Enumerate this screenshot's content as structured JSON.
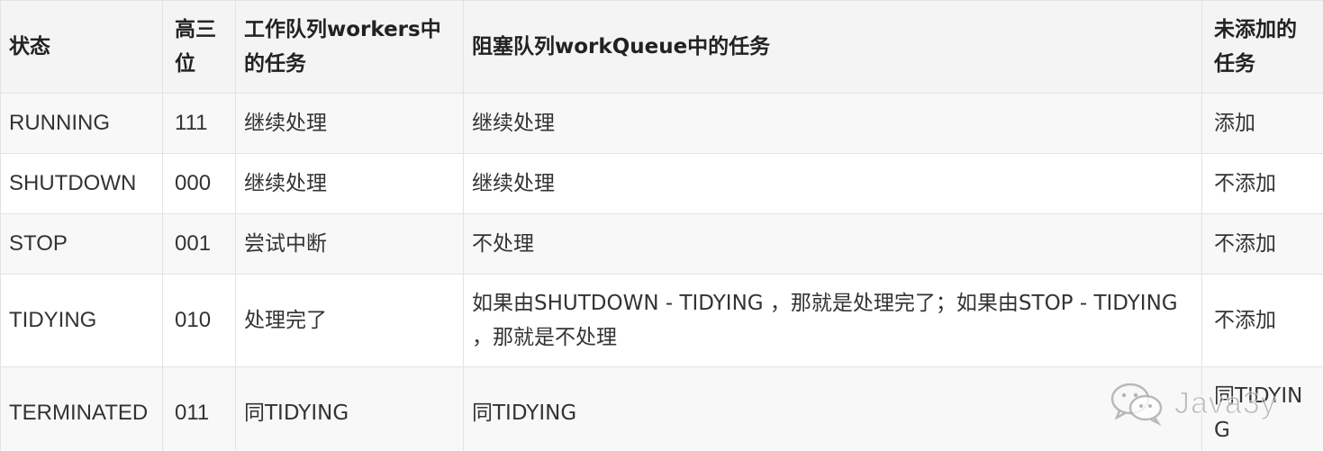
{
  "table": {
    "headers": {
      "state": "状态",
      "high_bits": "高三位",
      "workers_tasks": "工作队列workers中的任务",
      "queue_tasks": "阻塞队列workQueue中的任务",
      "new_tasks": "未添加的任务"
    },
    "rows": [
      {
        "state": "RUNNING",
        "high_bits": "111",
        "workers_tasks": "继续处理",
        "queue_tasks": "继续处理",
        "new_tasks": "添加"
      },
      {
        "state": "SHUTDOWN",
        "high_bits": "000",
        "workers_tasks": "继续处理",
        "queue_tasks": "继续处理",
        "new_tasks": "不添加"
      },
      {
        "state": "STOP",
        "high_bits": "001",
        "workers_tasks": "尝试中断",
        "queue_tasks": "不处理",
        "new_tasks": "不添加"
      },
      {
        "state": "TIDYING",
        "high_bits": "010",
        "workers_tasks": "处理完了",
        "queue_tasks": "如果由SHUTDOWN - TIDYING ，那就是处理完了；如果由STOP - TIDYING ，那就是不处理",
        "new_tasks": "不添加"
      },
      {
        "state": "TERMINATED",
        "high_bits": "011",
        "workers_tasks": "同TIDYING",
        "queue_tasks": "同TIDYING",
        "new_tasks": "同TIDYING"
      }
    ]
  },
  "watermark": {
    "icon": "wechat-icon",
    "text": "Java3y"
  }
}
